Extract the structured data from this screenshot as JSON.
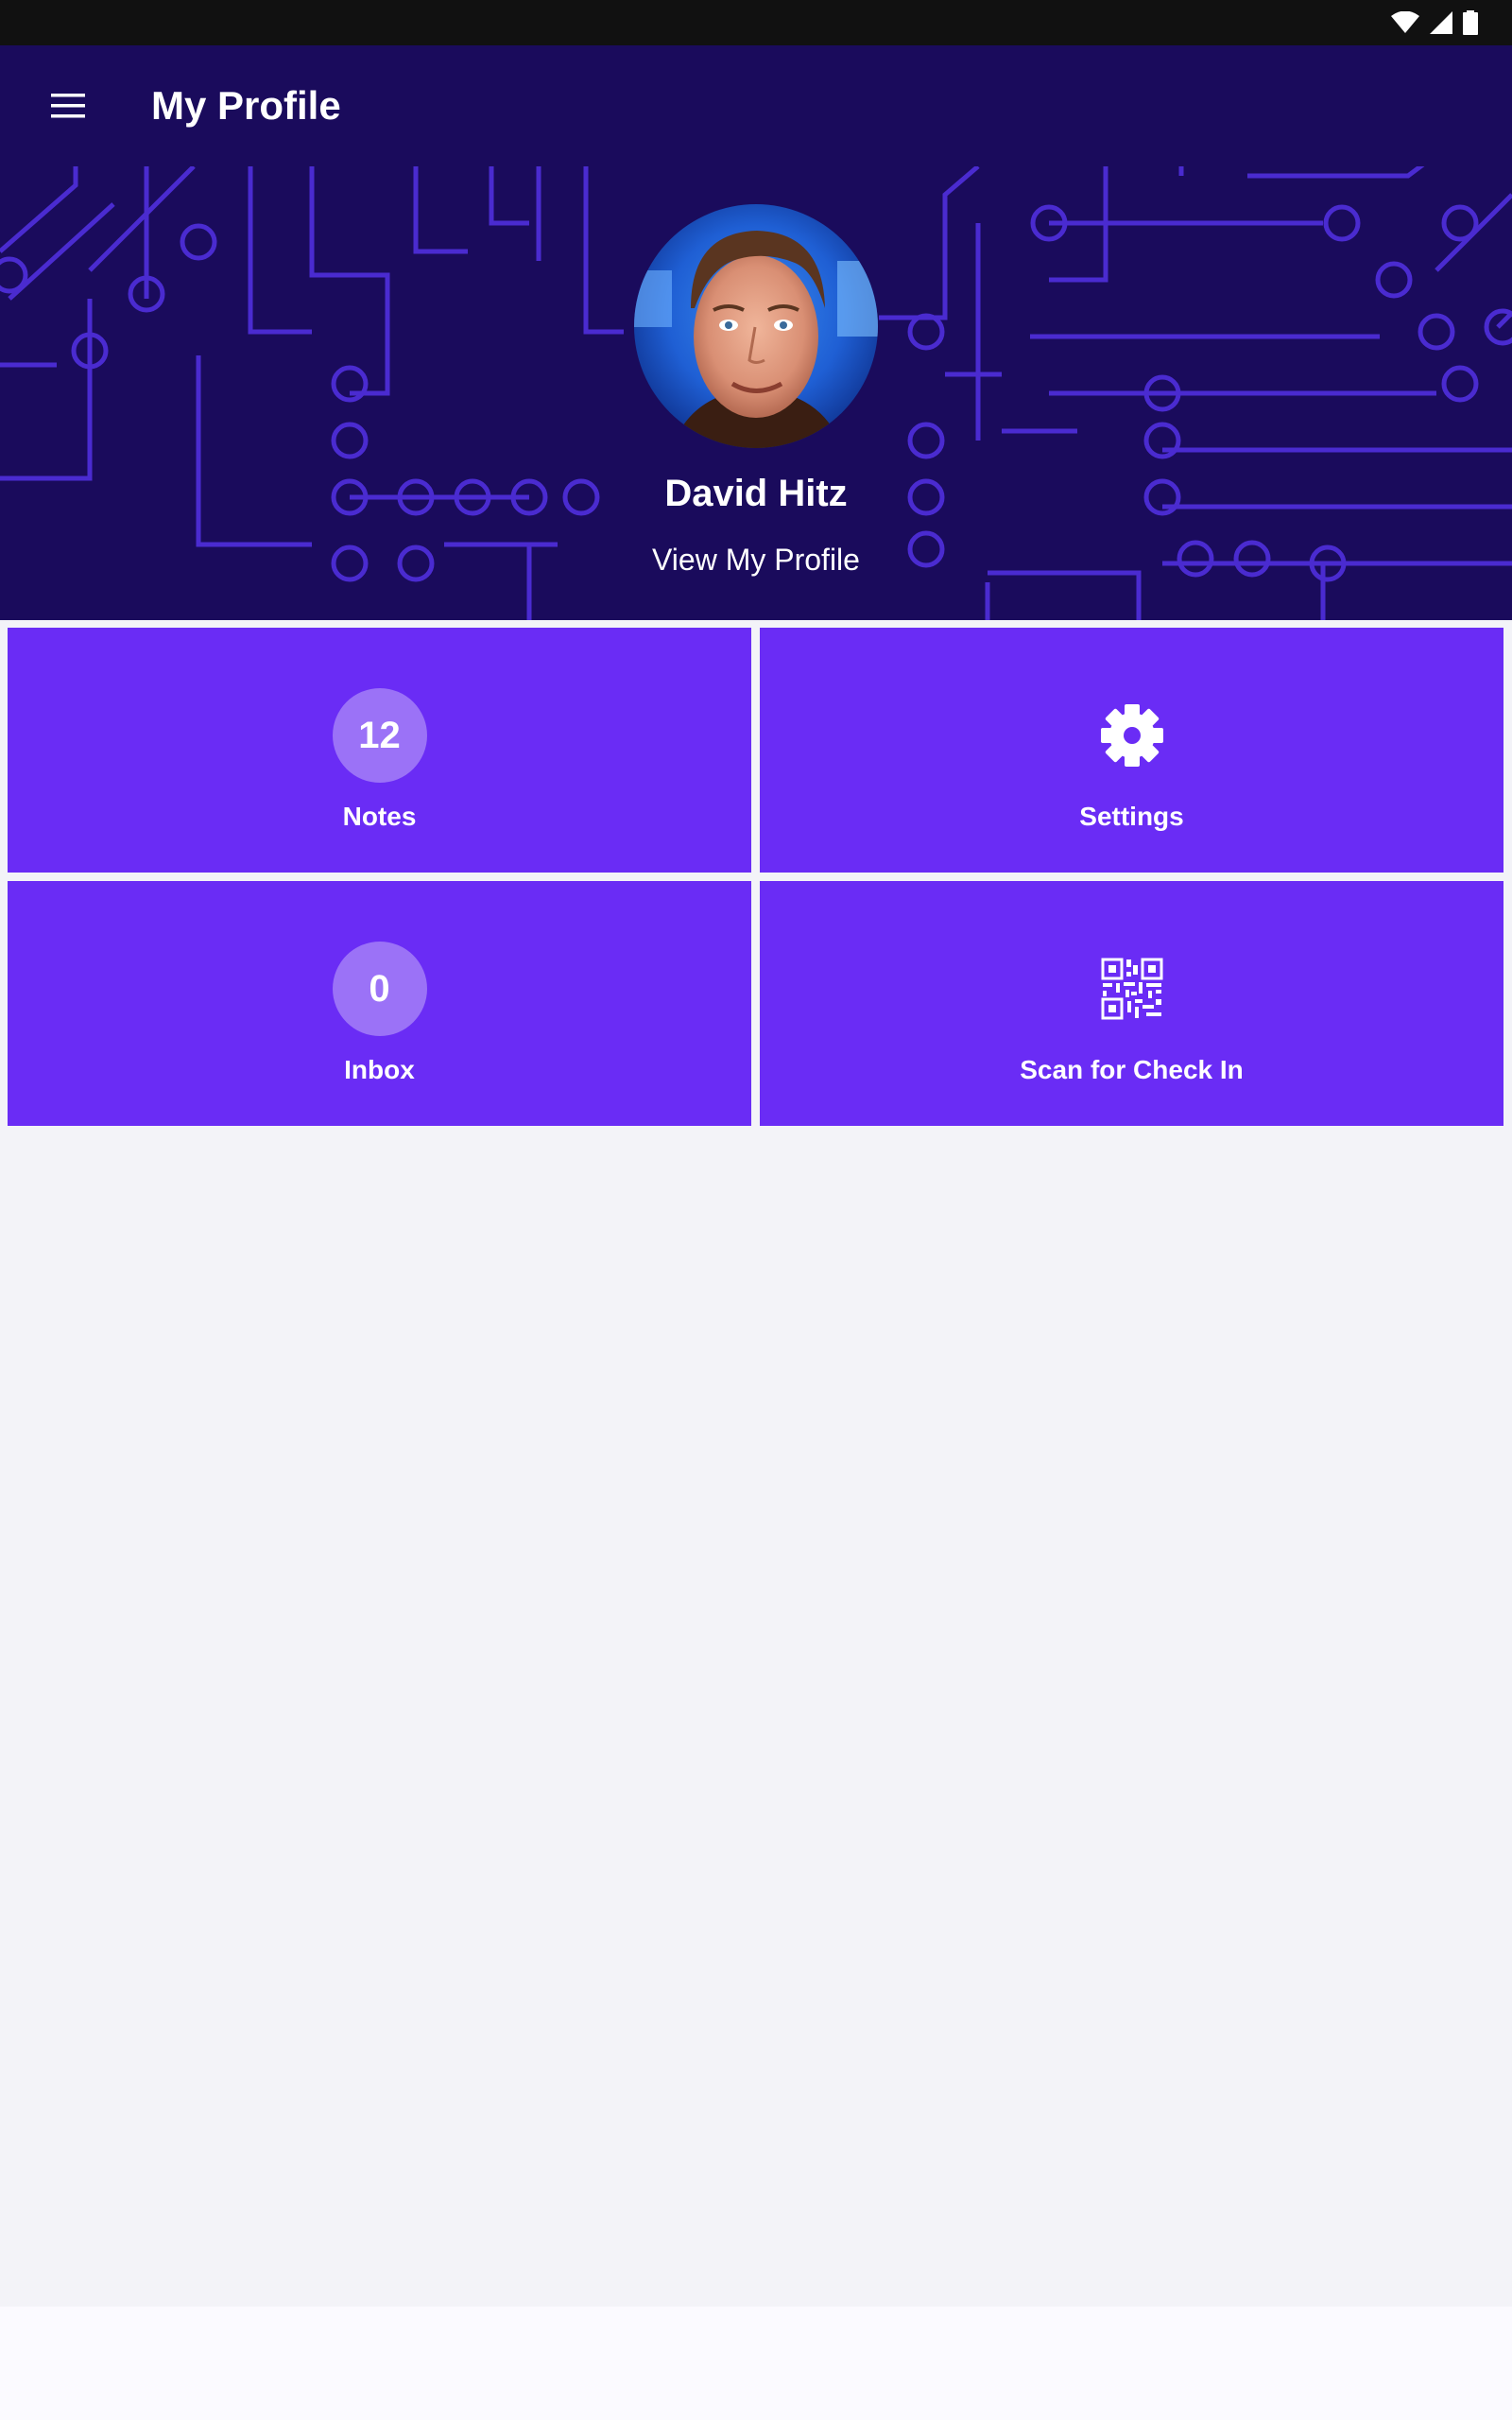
{
  "app_bar": {
    "title": "My Profile",
    "menu_icon": "hamburger-menu-icon"
  },
  "status_bar": {
    "icons": [
      "wifi-icon",
      "cellular-signal-icon",
      "battery-icon"
    ]
  },
  "profile": {
    "name": "David Hitz",
    "view_link": "View My Profile"
  },
  "tiles": [
    {
      "label": "Notes",
      "badge": "12"
    },
    {
      "label": "Settings",
      "icon": "gear-icon"
    },
    {
      "label": "Inbox",
      "badge": "0"
    },
    {
      "label": "Scan for Check In",
      "icon": "qr-code-icon"
    }
  ],
  "colors": {
    "header_bg": "#1a0b5c",
    "tile_bg": "#6a2cf5",
    "badge_bg": "#9b72f7",
    "circuit_lines": "#4a2bd0"
  }
}
